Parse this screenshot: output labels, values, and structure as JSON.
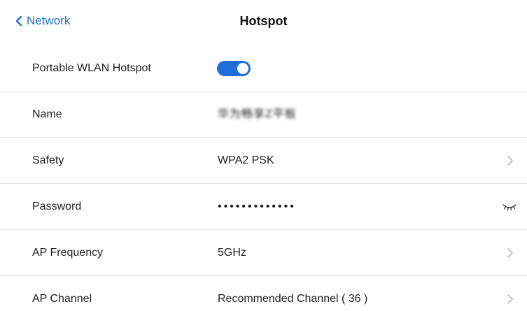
{
  "header": {
    "back_label": "Network",
    "title": "Hotspot"
  },
  "rows": [
    {
      "label": "Portable WLAN Hotspot",
      "toggle_on": true
    },
    {
      "label": "Name",
      "value": "华为畅享Z平板"
    },
    {
      "label": "Safety",
      "value": "WPA2 PSK"
    },
    {
      "label": "Password",
      "value": "•••••••••••••"
    },
    {
      "label": "AP Frequency",
      "value": "5GHz"
    },
    {
      "label": "AP Channel",
      "value": "Recommended Channel ( 36 )"
    }
  ],
  "colors": {
    "accent": "#1e6fd9",
    "divider": "#e6e6e6",
    "chevron": "#bdbdbd"
  },
  "icons": {
    "back": "chevron-left-icon",
    "row_nav": "chevron-right-icon",
    "password_visibility": "eye-closed-icon"
  }
}
